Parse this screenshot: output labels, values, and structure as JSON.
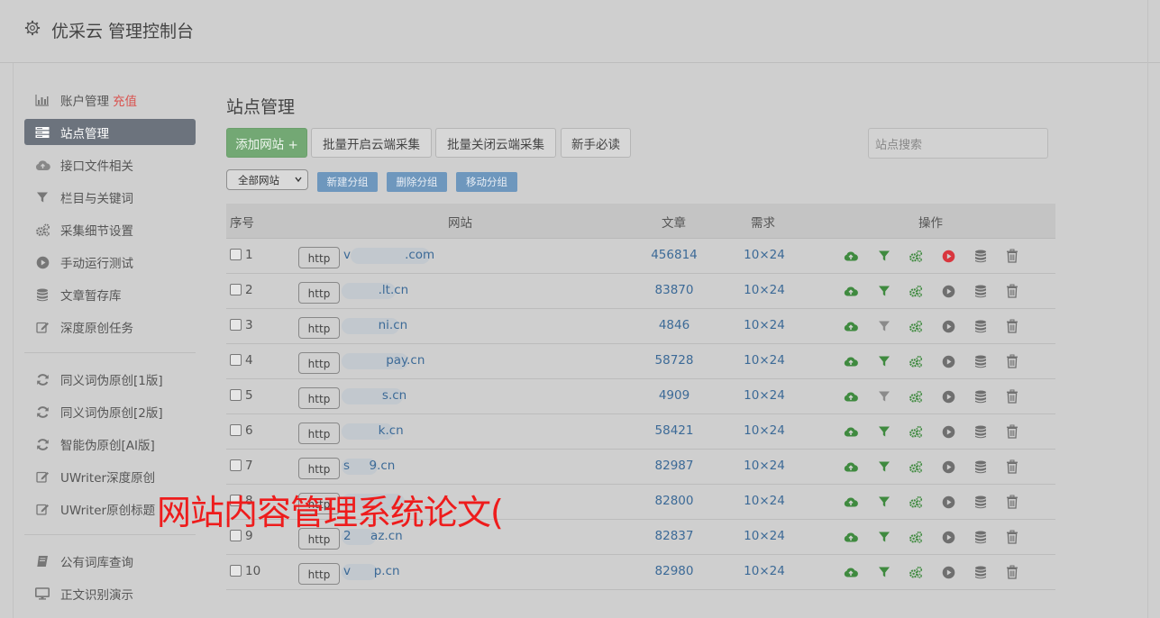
{
  "header": {
    "title": "优采云 管理控制台",
    "icon": "gear-icon"
  },
  "sidebar": {
    "groups": [
      [
        {
          "label": "账户管理",
          "badge": "充值",
          "icon": "bar-chart-icon"
        },
        {
          "label": "站点管理",
          "icon": "server-icon",
          "active": true
        },
        {
          "label": "接口文件相关",
          "icon": "cloud-icon"
        },
        {
          "label": "栏目与关键词",
          "icon": "filter-icon"
        },
        {
          "label": "采集细节设置",
          "icon": "cogs-icon"
        },
        {
          "label": "手动运行测试",
          "icon": "play-circle-icon"
        },
        {
          "label": "文章暂存库",
          "icon": "database-icon"
        },
        {
          "label": "深度原创任务",
          "icon": "edit-icon"
        }
      ],
      [
        {
          "label": "同义词伪原创[1版]",
          "icon": "refresh-icon"
        },
        {
          "label": "同义词伪原创[2版]",
          "icon": "refresh-icon"
        },
        {
          "label": "智能伪原创[AI版]",
          "icon": "refresh-icon"
        },
        {
          "label": "UWriter深度原创",
          "icon": "edit-icon"
        },
        {
          "label": "UWriter原创标题",
          "icon": "edit-icon"
        }
      ],
      [
        {
          "label": "公有词库查询",
          "icon": "book-icon"
        },
        {
          "label": "正文识别演示",
          "icon": "monitor-icon"
        }
      ]
    ]
  },
  "main": {
    "title": "站点管理",
    "buttons": {
      "add": "添加网站 +",
      "batch_on": "批量开启云端采集",
      "batch_off": "批量关闭云端采集",
      "guide": "新手必读"
    },
    "search_placeholder": "站点搜索",
    "group_select": "全部网站",
    "group_buttons": {
      "new": "新建分组",
      "delete": "删除分组",
      "move": "移动分组"
    },
    "columns": {
      "index": "序号",
      "site": "网站",
      "articles": "文章",
      "demand": "需求",
      "actions": "操作"
    },
    "rows": [
      {
        "num": "1",
        "prefix": "http",
        "site": "v              .com",
        "articles": "456814",
        "demand": "10×24",
        "filter_on": true,
        "running": true
      },
      {
        "num": "2",
        "prefix": "http",
        "site": "         .lt.cn",
        "articles": "83870",
        "demand": "10×24",
        "filter_on": true,
        "running": false
      },
      {
        "num": "3",
        "prefix": "http",
        "site": "         ni.cn",
        "articles": "4846",
        "demand": "10×24",
        "filter_on": false,
        "running": false
      },
      {
        "num": "4",
        "prefix": "http",
        "site": "           pay.cn",
        "articles": "58728",
        "demand": "10×24",
        "filter_on": true,
        "running": false
      },
      {
        "num": "5",
        "prefix": "http",
        "site": "          s.cn",
        "articles": "4909",
        "demand": "10×24",
        "filter_on": false,
        "running": false
      },
      {
        "num": "6",
        "prefix": "http",
        "site": "         k.cn",
        "articles": "58421",
        "demand": "10×24",
        "filter_on": true,
        "running": false
      },
      {
        "num": "7",
        "prefix": "http",
        "site": "s     9.cn",
        "articles": "82987",
        "demand": "10×24",
        "filter_on": true,
        "running": false
      },
      {
        "num": "8",
        "prefix": "http",
        "site": "",
        "articles": "82800",
        "demand": "10×24",
        "filter_on": true,
        "running": false
      },
      {
        "num": "9",
        "prefix": "http",
        "site": "2     az.cn",
        "articles": "82837",
        "demand": "10×24",
        "filter_on": true,
        "running": false
      },
      {
        "num": "10",
        "prefix": "http",
        "site": "v      p.cn",
        "articles": "82980",
        "demand": "10×24",
        "filter_on": true,
        "running": false
      }
    ],
    "action_icons": [
      "cloud-upload-icon",
      "filter-icon",
      "cogs-icon",
      "play-circle-icon",
      "database-icon",
      "trash-icon"
    ]
  },
  "overlay_text": "网站内容管理系统论文(",
  "colors": {
    "green": "#3f8a3f",
    "red_play": "#d9363e",
    "grey_icon": "#6f6f6f",
    "link": "#3c6a97",
    "active_nav": "#6c737d"
  }
}
